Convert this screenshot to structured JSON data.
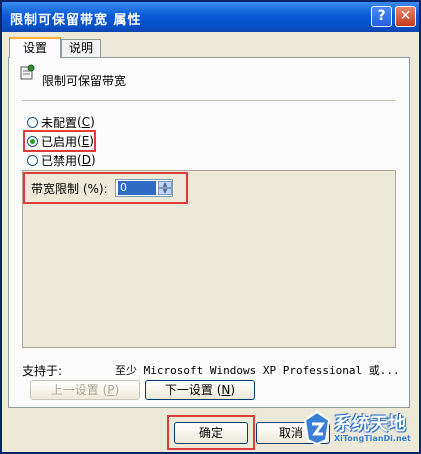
{
  "window": {
    "title": "限制可保留带宽 属性",
    "help_label": "?",
    "close_label": "✕"
  },
  "tabs": [
    {
      "label": "设置",
      "active": true
    },
    {
      "label": "说明",
      "active": false
    }
  ],
  "policy": {
    "icon": "policy-setting-icon",
    "name": "限制可保留带宽"
  },
  "state_options": [
    {
      "label": "未配置",
      "key": "C",
      "selected": false
    },
    {
      "label": "已启用",
      "key": "E",
      "selected": true
    },
    {
      "label": "已禁用",
      "key": "D",
      "selected": false
    }
  ],
  "bandwidth": {
    "label": "带宽限制 (%):",
    "value": "0"
  },
  "support": {
    "label": "支持于:",
    "value": "至少 Microsoft Windows XP Professional 或..."
  },
  "nav_buttons": {
    "prev_label": "上一设置",
    "prev_key": "P",
    "next_label": "下一设置",
    "next_key": "N"
  },
  "dialog_buttons": {
    "ok_label": "确定",
    "cancel_label": "取消"
  },
  "watermark": {
    "name": "系统天地",
    "url": "XiTongTianDi.net"
  },
  "colors": {
    "titlebar": "#0a5ad8",
    "highlight_box": "#e03b3b",
    "selected_value_bg": "#316ac5"
  }
}
